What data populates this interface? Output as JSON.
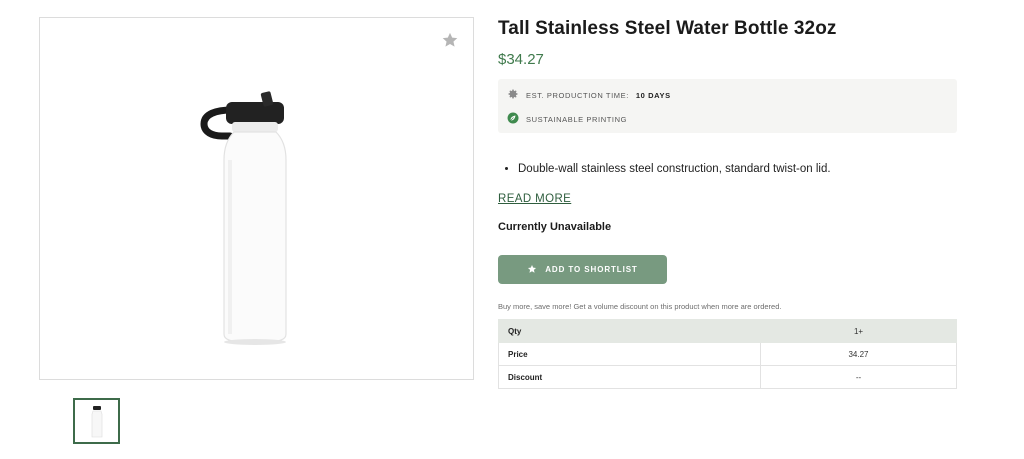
{
  "product": {
    "title": "Tall Stainless Steel Water Bottle 32oz",
    "price": "$34.27",
    "image_alt": "white stainless steel water bottle with black lid"
  },
  "info": {
    "production_label": "EST. PRODUCTION TIME:",
    "production_value": "10 DAYS",
    "sustainable_label": "SUSTAINABLE PRINTING"
  },
  "description": {
    "bullets": [
      "Double-wall stainless steel construction, standard twist-on lid."
    ]
  },
  "read_more": "READ MORE",
  "availability": "Currently Unavailable",
  "shortlist_button": "ADD TO SHORTLIST",
  "volume_note": "Buy more, save more! Get a volume discount on this product when more are ordered.",
  "pricing_table": {
    "rows": [
      {
        "label": "Qty",
        "value": "1+"
      },
      {
        "label": "Price",
        "value": "34.27"
      },
      {
        "label": "Discount",
        "value": "--"
      }
    ]
  },
  "colors": {
    "accent_green": "#3f7a4c",
    "button_green": "#789a80",
    "table_header": "#e4e8e3"
  },
  "icons": [
    "star-icon",
    "gear-icon",
    "leaf-icon"
  ]
}
